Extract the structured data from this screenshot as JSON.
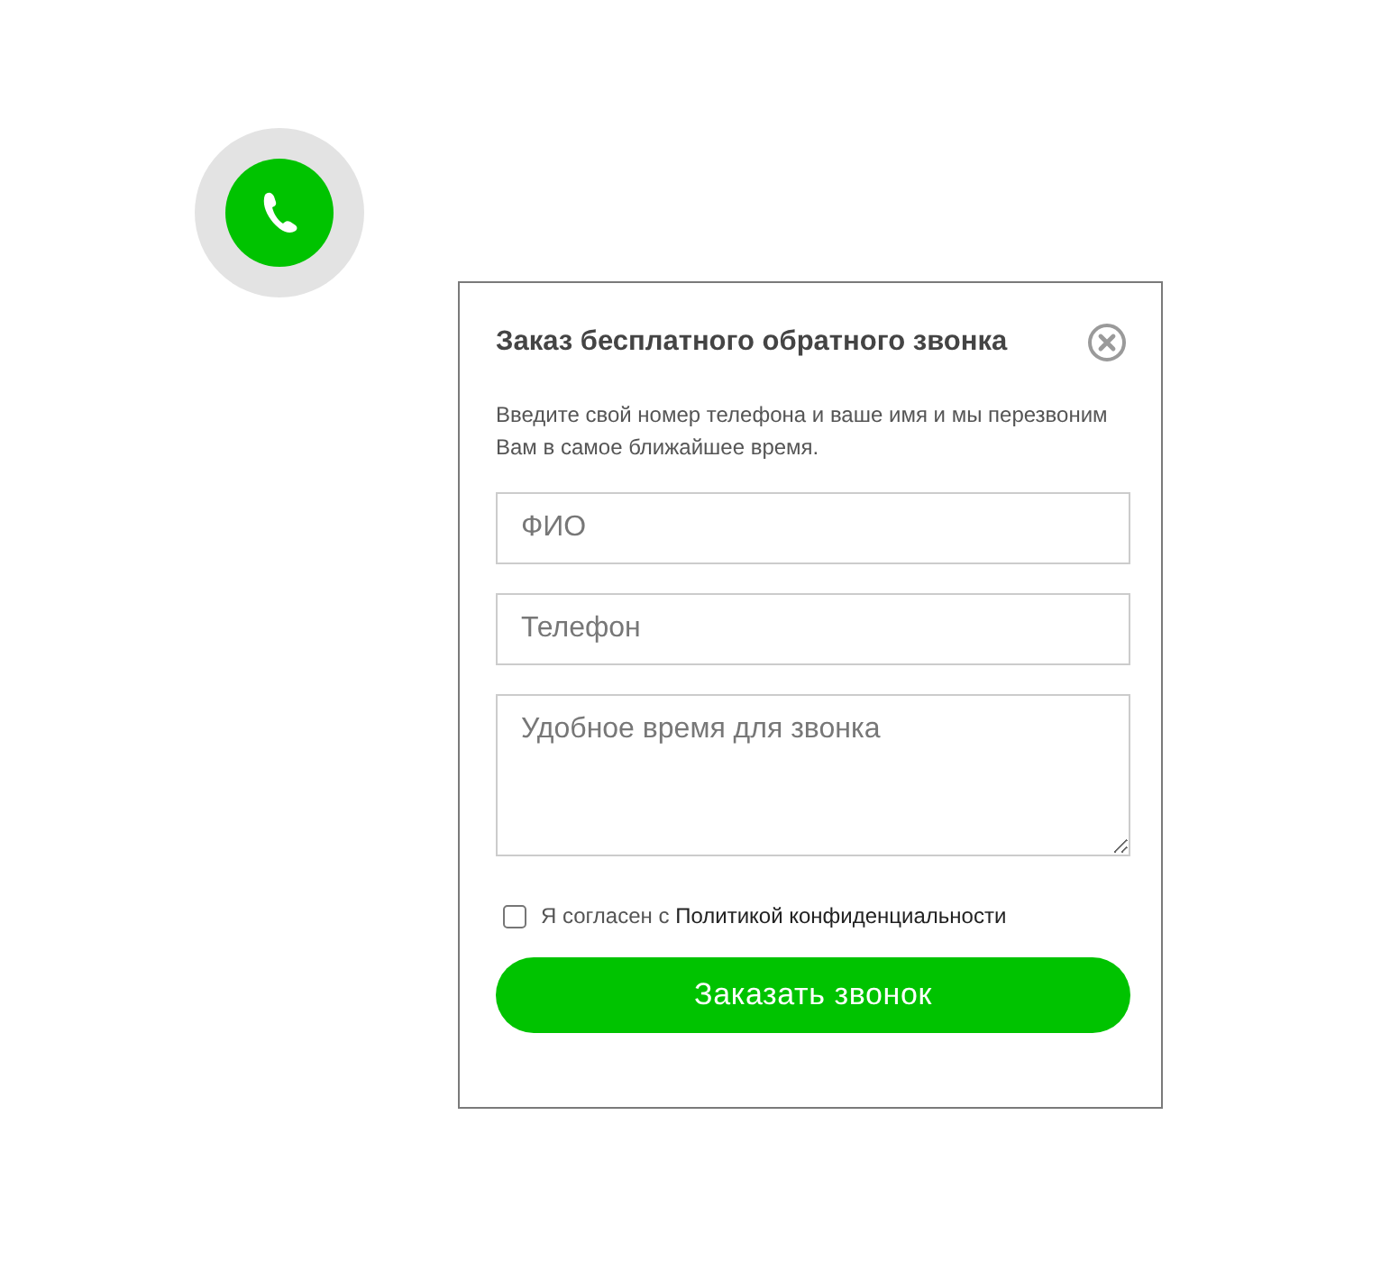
{
  "modal": {
    "title": "Заказ бесплатного обратного звонка",
    "description": "Введите свой номер телефона и ваше имя и мы перезвоним Вам в самое ближайшее время.",
    "fields": [
      {
        "kind": "input",
        "placeholder": "ФИО"
      },
      {
        "kind": "input",
        "placeholder": "Телефон"
      },
      {
        "kind": "textarea",
        "placeholder": "Удобное время для звонка"
      }
    ],
    "consent": {
      "checked": false,
      "text": "Я согласен с ",
      "link": "Политикой конфиденциальности"
    },
    "submit": "Заказать звонок"
  }
}
